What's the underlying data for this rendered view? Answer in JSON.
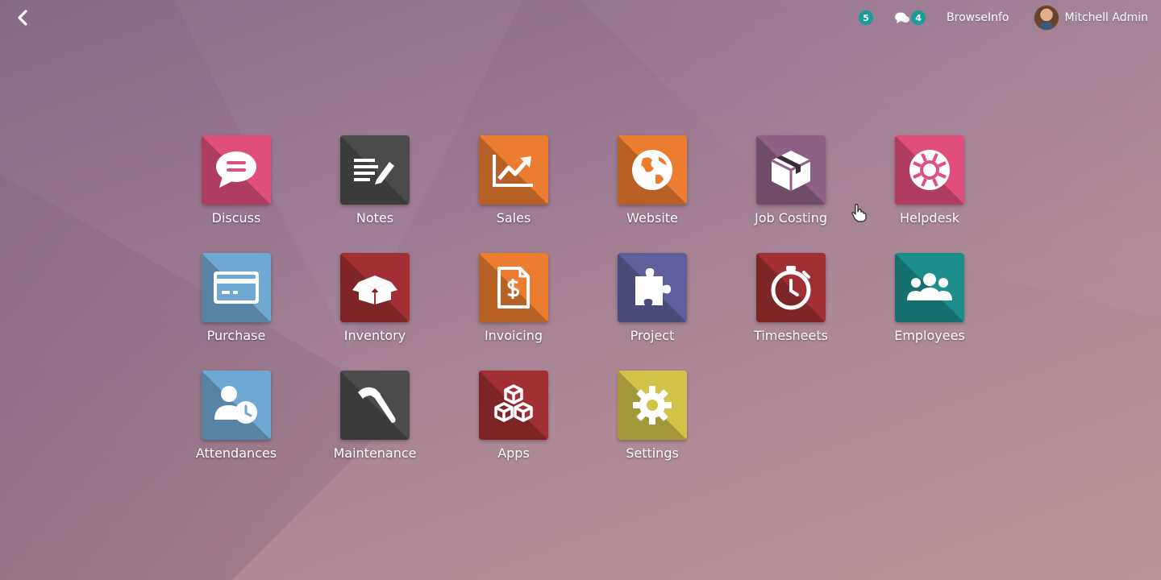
{
  "topbar": {
    "activity_count": "5",
    "messages_count": "4",
    "company": "BrowseInfo",
    "user_name": "Mitchell Admin"
  },
  "apps": [
    {
      "label": "Discuss",
      "color": "#e04e7c",
      "icon": "chat-bubble-icon"
    },
    {
      "label": "Notes",
      "color": "#4b4b4b",
      "icon": "note-pencil-icon"
    },
    {
      "label": "Sales",
      "color": "#ec7c30",
      "icon": "trend-chart-icon"
    },
    {
      "label": "Website",
      "color": "#ec7c30",
      "icon": "globe-icon"
    },
    {
      "label": "Job Costing",
      "color": "#8e6184",
      "icon": "package-box-icon"
    },
    {
      "label": "Helpdesk",
      "color": "#e04e7c",
      "icon": "lifebuoy-icon"
    },
    {
      "label": "Purchase",
      "color": "#6fa8d2",
      "icon": "credit-card-icon"
    },
    {
      "label": "Inventory",
      "color": "#a12f33",
      "icon": "open-box-icon"
    },
    {
      "label": "Invoicing",
      "color": "#ec7c30",
      "icon": "invoice-dollar-icon"
    },
    {
      "label": "Project",
      "color": "#5f5f9e",
      "icon": "puzzle-piece-icon"
    },
    {
      "label": "Timesheets",
      "color": "#a12f33",
      "icon": "stopwatch-icon"
    },
    {
      "label": "Employees",
      "color": "#1b8e8a",
      "icon": "group-users-icon"
    },
    {
      "label": "Attendances",
      "color": "#6fa8d2",
      "icon": "user-clock-icon"
    },
    {
      "label": "Maintenance",
      "color": "#4b4b4b",
      "icon": "hammer-icon"
    },
    {
      "label": "Apps",
      "color": "#a12f33",
      "icon": "cubes-icon"
    },
    {
      "label": "Settings",
      "color": "#cfc34a",
      "icon": "gear-icon"
    }
  ]
}
